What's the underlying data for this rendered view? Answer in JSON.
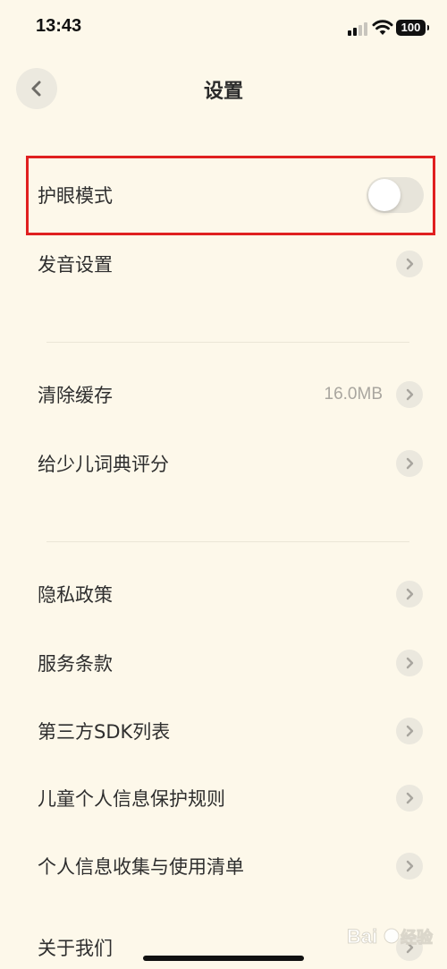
{
  "status_bar": {
    "time": "13:43",
    "battery": "100"
  },
  "nav": {
    "back_icon": "chevron-left-icon",
    "title": "设置"
  },
  "highlight_color": "#e02020",
  "section_1": {
    "eye_mode_label": "护眼模式",
    "eye_mode_enabled": false,
    "pronunciation_label": "发音设置"
  },
  "section_2": {
    "clear_cache_label": "清除缓存",
    "cache_size": "16.0MB",
    "rate_label": "给少儿词典评分"
  },
  "section_3": {
    "privacy_label": "隐私政策",
    "terms_label": "服务条款",
    "sdk_label": "第三方SDK列表",
    "child_info_label": "儿童个人信息保护规则",
    "info_collection_label": "个人信息收集与使用清单",
    "about_label": "关于我们"
  }
}
